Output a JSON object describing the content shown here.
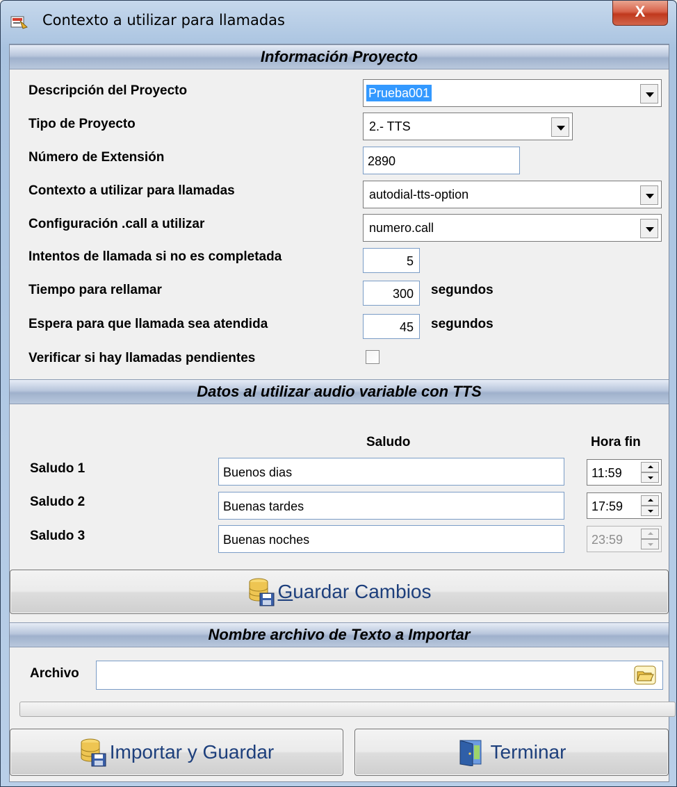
{
  "window": {
    "title": "Contexto a utilizar para llamadas",
    "close_label": "X"
  },
  "section_project": {
    "header": "Información Proyecto",
    "descripcion_label": "Descripción del Proyecto",
    "descripcion_value": "Prueba001",
    "tipo_label": "Tipo de Proyecto",
    "tipo_value": "2.- TTS",
    "extension_label": "Número de Extensión",
    "extension_value": "2890",
    "contexto_label": "Contexto a utilizar para llamadas",
    "contexto_value": "autodial-tts-option",
    "config_label": "Configuración .call a utilizar",
    "config_value": "numero.call",
    "intentos_label": "Intentos de llamada si no es completada",
    "intentos_value": "5",
    "tiempo_label": "Tiempo para rellamar",
    "tiempo_value": "300",
    "tiempo_unit": "segundos",
    "espera_label": "Espera para que llamada sea atendida",
    "espera_value": "45",
    "espera_unit": "segundos",
    "verificar_label": "Verificar si hay llamadas pendientes",
    "verificar_checked": false
  },
  "section_tts": {
    "header": "Datos al utilizar audio variable con TTS",
    "col_saludo": "Saludo",
    "col_hora_fin": "Hora fin",
    "rows": [
      {
        "label": "Saludo 1",
        "saludo": "Buenos dias",
        "hora": "11:59",
        "enabled": true
      },
      {
        "label": "Saludo 2",
        "saludo": "Buenas tardes",
        "hora": "17:59",
        "enabled": true
      },
      {
        "label": "Saludo 3",
        "saludo": "Buenas noches",
        "hora": "23:59",
        "enabled": false
      }
    ]
  },
  "guardar_button": {
    "accel": "G",
    "rest": "uardar Cambios"
  },
  "section_import": {
    "header": "Nombre archivo de Texto a Importar",
    "archivo_label": "Archivo",
    "archivo_value": "",
    "progress": 0
  },
  "bottom_buttons": {
    "importar_label": "Importar y Guardar",
    "terminar_label": "Terminar"
  },
  "colors": {
    "accent_text": "#1d3f7c",
    "selection": "#3399ff",
    "close_button": "#c0391d"
  }
}
